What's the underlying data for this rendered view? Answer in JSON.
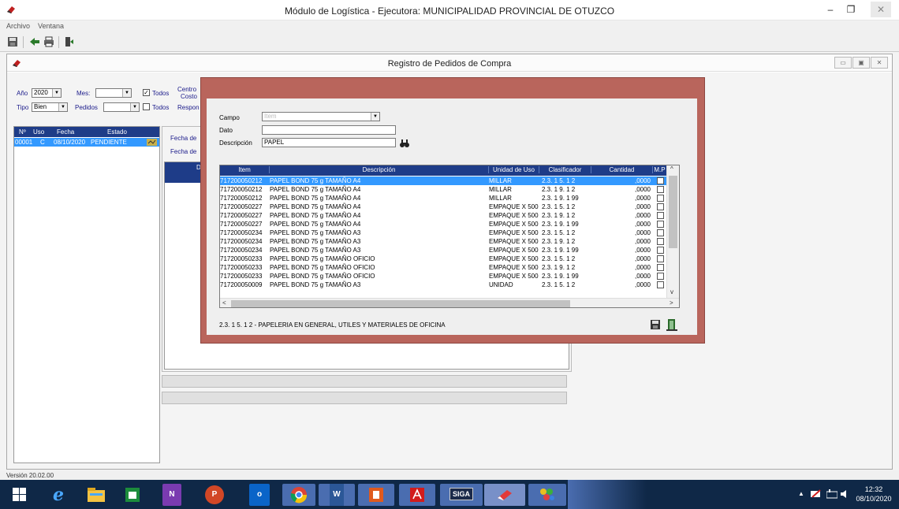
{
  "window": {
    "title": "Módulo de Logística - Ejecutora: MUNICIPALIDAD PROVINCIAL DE OTUZCO",
    "minimize": "–",
    "maximize": "❐",
    "close": "✕"
  },
  "menu": {
    "items": [
      "Archivo",
      "Ventana"
    ]
  },
  "toolbar": {
    "icons": [
      "save-icon",
      "back-icon",
      "print-icon",
      "exit-icon"
    ]
  },
  "mdi": {
    "title": "Registro de Pedidos de Compra",
    "controls": [
      "▭",
      "▣",
      "✕"
    ]
  },
  "filters": {
    "year_label": "Año",
    "year_value": "2020",
    "month_label": "Mes:",
    "month_value": "",
    "todos1_label": "Todos",
    "todos1_checked": "✓",
    "centro_label_1": "Centro",
    "centro_label_2": "Costo",
    "tipo_label": "Tipo",
    "tipo_value": "Bien",
    "pedidos_label": "Pedidos",
    "pedidos_value": "",
    "todos2_label": "Todos",
    "respon_label": "Respon"
  },
  "left_grid": {
    "columns": [
      "Nº",
      "Uso",
      "Fecha",
      "Estado"
    ],
    "row": {
      "num": "00001",
      "uso": "C",
      "fecha": "08/10/2020",
      "estado": "PENDIENTE"
    }
  },
  "middle": {
    "fecha1_label": "Fecha de",
    "fecha2_label": "Fecha de",
    "col_header": "De"
  },
  "dialog": {
    "campo_label": "Campo",
    "campo_placeholder": "Item",
    "dato_label": "Dato",
    "dato_value": "",
    "descripcion_label": "Descripción",
    "descripcion_value": "PAPEL",
    "columns": [
      "Item",
      "Descripción",
      "Unidad de Uso",
      "Clasificador",
      "Cantidad",
      "M.P"
    ],
    "rows": [
      {
        "item": "717200050212",
        "desc": "PAPEL BOND  75 g TAMAÑO A4",
        "unidad": "MILLAR",
        "clasif": "2.3. 1 5. 1 2",
        "cant": ",0000"
      },
      {
        "item": "717200050212",
        "desc": "PAPEL BOND  75 g TAMAÑO A4",
        "unidad": "MILLAR",
        "clasif": "2.3. 1 9. 1 2",
        "cant": ",0000"
      },
      {
        "item": "717200050212",
        "desc": "PAPEL BOND  75 g TAMAÑO A4",
        "unidad": "MILLAR",
        "clasif": "2.3. 1 9. 1 99",
        "cant": ",0000"
      },
      {
        "item": "717200050227",
        "desc": "PAPEL BOND 75 g TAMAÑO A4",
        "unidad": "EMPAQUE X 500",
        "clasif": "2.3. 1 5. 1 2",
        "cant": ",0000"
      },
      {
        "item": "717200050227",
        "desc": "PAPEL BOND 75 g TAMAÑO A4",
        "unidad": "EMPAQUE X 500",
        "clasif": "2.3. 1 9. 1 2",
        "cant": ",0000"
      },
      {
        "item": "717200050227",
        "desc": "PAPEL BOND 75 g TAMAÑO A4",
        "unidad": "EMPAQUE X 500",
        "clasif": "2.3. 1 9. 1 99",
        "cant": ",0000"
      },
      {
        "item": "717200050234",
        "desc": "PAPEL BOND 75 g TAMAÑO  A3",
        "unidad": "EMPAQUE X 500",
        "clasif": "2.3. 1 5. 1 2",
        "cant": ",0000"
      },
      {
        "item": "717200050234",
        "desc": "PAPEL BOND 75 g TAMAÑO  A3",
        "unidad": "EMPAQUE X 500",
        "clasif": "2.3. 1 9. 1 2",
        "cant": ",0000"
      },
      {
        "item": "717200050234",
        "desc": "PAPEL BOND 75 g TAMAÑO  A3",
        "unidad": "EMPAQUE X 500",
        "clasif": "2.3. 1 9. 1 99",
        "cant": ",0000"
      },
      {
        "item": "717200050233",
        "desc": "PAPEL BOND 75 g TAMAÑO  OFICIO",
        "unidad": "EMPAQUE X 500",
        "clasif": "2.3. 1 5. 1 2",
        "cant": ",0000"
      },
      {
        "item": "717200050233",
        "desc": "PAPEL BOND 75 g TAMAÑO  OFICIO",
        "unidad": "EMPAQUE X 500",
        "clasif": "2.3. 1 9. 1 2",
        "cant": ",0000"
      },
      {
        "item": "717200050233",
        "desc": "PAPEL BOND 75 g TAMAÑO  OFICIO",
        "unidad": "EMPAQUE X 500",
        "clasif": "2.3. 1 9. 1 99",
        "cant": ",0000"
      },
      {
        "item": "717200050009",
        "desc": "PAPEL BOND 75 g TAMAÑO A3",
        "unidad": "UNIDAD",
        "clasif": "2.3. 1 5. 1 2",
        "cant": ",0000"
      }
    ],
    "footer_text": "2.3. 1 5. 1 2 - PAPELERIA EN GENERAL, UTILES Y MATERIALES DE OFICINA"
  },
  "status": {
    "version": "Versión 20.02.00"
  },
  "taskbar": {
    "apps": [
      "start",
      "Internet Explorer",
      "File Explorer",
      "Store",
      "OneNote",
      "PowerPoint",
      "Outlook",
      "Chrome",
      "Word",
      "Office",
      "Acrobat",
      "SIGA",
      "Logística",
      "Paint"
    ],
    "siga_label": "SIGA",
    "onenote_label": "N",
    "powerpoint_label": "P",
    "outlook_label": "o",
    "word_label": "W",
    "time": "12:32",
    "date": "08/10/2020"
  },
  "colors": {
    "header_blue": "#1e3c88",
    "selection": "#3399ff",
    "dialog_frame": "#b9655c",
    "taskbar": "#0f2847"
  }
}
